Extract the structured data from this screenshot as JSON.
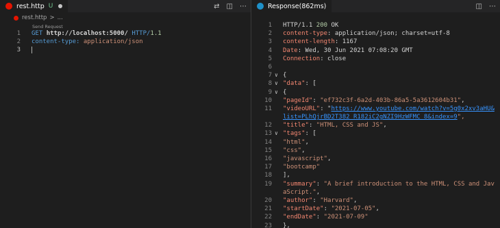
{
  "left_editor": {
    "tab": {
      "filename": "rest.http",
      "git_status": "U"
    },
    "actions": [
      "⇄",
      "◫",
      "⋯"
    ],
    "breadcrumb": {
      "filename": "rest.http",
      "separator": ">",
      "tail": "..."
    },
    "codelens": "Send Request",
    "lines": [
      {
        "n": "1",
        "tokens": [
          {
            "t": "GET ",
            "c": "kw"
          },
          {
            "t": "http://localhost:5000/",
            "c": "plain bold"
          },
          {
            "t": " HTTP/",
            "c": "kw"
          },
          {
            "t": "1.1",
            "c": "num"
          }
        ]
      },
      {
        "n": "2",
        "tokens": [
          {
            "t": "content-type:",
            "c": "kw"
          },
          {
            "t": " application/json",
            "c": "str"
          }
        ]
      },
      {
        "n": "3",
        "tokens": []
      }
    ]
  },
  "right_editor": {
    "tab": {
      "title": "Response(862ms)"
    },
    "actions": [
      "◫",
      "⋯"
    ],
    "lines": [
      {
        "n": "1",
        "tokens": [
          {
            "t": "HTTP/1.1 ",
            "c": "plain"
          },
          {
            "t": "200",
            "c": "num"
          },
          {
            "t": " OK",
            "c": "plain"
          }
        ]
      },
      {
        "n": "2",
        "tokens": [
          {
            "t": "content-type",
            "c": "key"
          },
          {
            "t": ": application/json; charset=utf-8",
            "c": "plain"
          }
        ]
      },
      {
        "n": "3",
        "tokens": [
          {
            "t": "content-length",
            "c": "key"
          },
          {
            "t": ": 1167",
            "c": "plain"
          }
        ]
      },
      {
        "n": "4",
        "tokens": [
          {
            "t": "Date",
            "c": "key"
          },
          {
            "t": ": Wed, 30 Jun 2021 07:08:20 GMT",
            "c": "plain"
          }
        ]
      },
      {
        "n": "5",
        "tokens": [
          {
            "t": "Connection",
            "c": "key"
          },
          {
            "t": ": close",
            "c": "plain"
          }
        ]
      },
      {
        "n": "6",
        "tokens": []
      },
      {
        "n": "7",
        "fold": true,
        "tokens": [
          {
            "t": "{",
            "c": "plain"
          }
        ]
      },
      {
        "n": "8",
        "fold": true,
        "tokens": [
          {
            "t": "  \"data\"",
            "c": "key"
          },
          {
            "t": ": [",
            "c": "plain"
          }
        ]
      },
      {
        "n": "9",
        "fold": true,
        "tokens": [
          {
            "t": "    {",
            "c": "plain"
          }
        ]
      },
      {
        "n": "10",
        "tokens": [
          {
            "t": "      \"pageId\"",
            "c": "key"
          },
          {
            "t": ": ",
            "c": "plain"
          },
          {
            "t": "\"ef732c3f-6a2d-403b-86a5-5a3612604b31\"",
            "c": "str"
          },
          {
            "t": ",",
            "c": "plain"
          }
        ]
      },
      {
        "n": "11",
        "tokens": [
          {
            "t": "      \"videoURL\"",
            "c": "key"
          },
          {
            "t": ": \"",
            "c": "plain"
          },
          {
            "t": "https://www.youtube.com/watch?v=5g0x2xv3aHU&",
            "c": "url"
          }
        ]
      },
      {
        "n": "",
        "tokens": [
          {
            "t": "list=PLhQjrBD2T382_R182iC2gNZI9HzWFMC_8&index=9",
            "c": "url"
          },
          {
            "t": "\",",
            "c": "str"
          }
        ]
      },
      {
        "n": "12",
        "tokens": [
          {
            "t": "      \"title\"",
            "c": "key"
          },
          {
            "t": ": ",
            "c": "plain"
          },
          {
            "t": "\"HTML, CSS and JS\"",
            "c": "str"
          },
          {
            "t": ",",
            "c": "plain"
          }
        ]
      },
      {
        "n": "13",
        "fold": true,
        "tokens": [
          {
            "t": "      \"tags\"",
            "c": "key"
          },
          {
            "t": ": [",
            "c": "plain"
          }
        ]
      },
      {
        "n": "14",
        "tokens": [
          {
            "t": "        \"html\"",
            "c": "str"
          },
          {
            "t": ",",
            "c": "plain"
          }
        ]
      },
      {
        "n": "15",
        "tokens": [
          {
            "t": "        \"css\"",
            "c": "str"
          },
          {
            "t": ",",
            "c": "plain"
          }
        ]
      },
      {
        "n": "16",
        "tokens": [
          {
            "t": "        \"javascript\"",
            "c": "str"
          },
          {
            "t": ",",
            "c": "plain"
          }
        ]
      },
      {
        "n": "17",
        "tokens": [
          {
            "t": "        \"bootcamp\"",
            "c": "str"
          }
        ]
      },
      {
        "n": "18",
        "tokens": [
          {
            "t": "      ],",
            "c": "plain"
          }
        ]
      },
      {
        "n": "19",
        "tokens": [
          {
            "t": "      \"summary\"",
            "c": "key"
          },
          {
            "t": ": ",
            "c": "plain"
          },
          {
            "t": "\"A brief introduction to the HTML, CSS and Jav",
            "c": "str"
          }
        ]
      },
      {
        "n": "",
        "tokens": [
          {
            "t": "aScript.\"",
            "c": "str"
          },
          {
            "t": ",",
            "c": "plain"
          }
        ]
      },
      {
        "n": "20",
        "tokens": [
          {
            "t": "      \"author\"",
            "c": "key"
          },
          {
            "t": ": ",
            "c": "plain"
          },
          {
            "t": "\"Harvard\"",
            "c": "str"
          },
          {
            "t": ",",
            "c": "plain"
          }
        ]
      },
      {
        "n": "21",
        "tokens": [
          {
            "t": "      \"startDate\"",
            "c": "key"
          },
          {
            "t": ": ",
            "c": "plain"
          },
          {
            "t": "\"2021-07-05\"",
            "c": "str"
          },
          {
            "t": ",",
            "c": "plain"
          }
        ]
      },
      {
        "n": "22",
        "tokens": [
          {
            "t": "      \"endDate\"",
            "c": "key"
          },
          {
            "t": ": ",
            "c": "plain"
          },
          {
            "t": "\"2021-07-09\"",
            "c": "str"
          }
        ]
      },
      {
        "n": "23",
        "tokens": [
          {
            "t": "    },",
            "c": "plain"
          }
        ]
      }
    ]
  },
  "colors": {
    "http_file_icon": "#e51400",
    "response_icon": "#1e90c8",
    "untracked": "#73c991"
  }
}
